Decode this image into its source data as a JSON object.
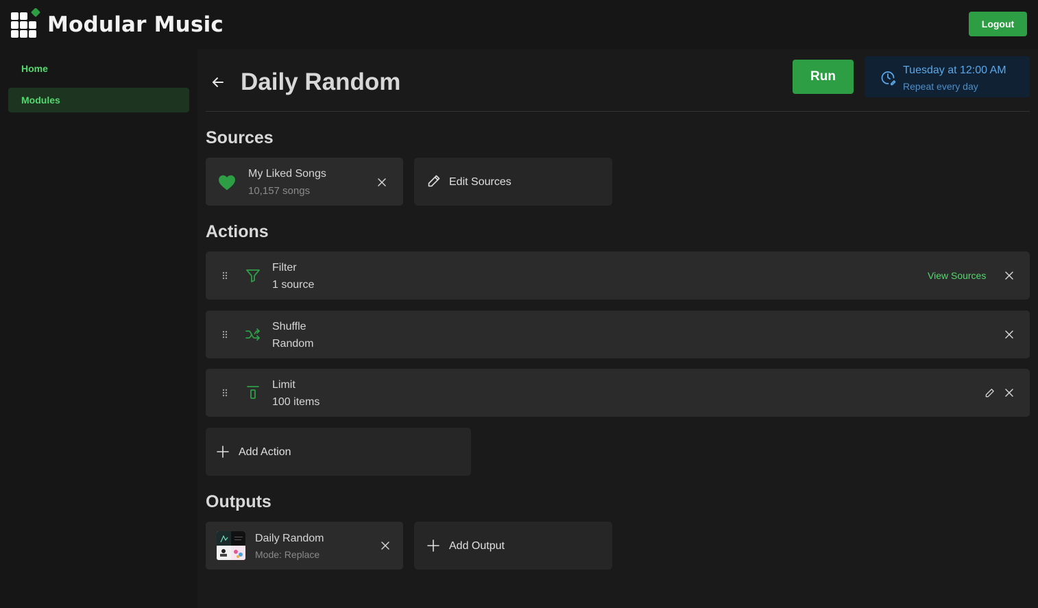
{
  "app": {
    "title": "Modular Music",
    "logout_label": "Logout"
  },
  "sidebar": {
    "items": [
      {
        "label": "Home"
      },
      {
        "label": "Modules"
      }
    ]
  },
  "page": {
    "title": "Daily Random",
    "run_label": "Run",
    "schedule": {
      "time": "Tuesday at 12:00 AM",
      "repeat": "Repeat every day"
    }
  },
  "sources": {
    "heading": "Sources",
    "items": [
      {
        "name": "My Liked Songs",
        "detail": "10,157 songs",
        "icon": "heart-icon"
      }
    ],
    "edit_label": "Edit Sources"
  },
  "actions": {
    "heading": "Actions",
    "items": [
      {
        "name": "Filter",
        "detail": "1 source",
        "icon": "filter-icon",
        "link": "View Sources"
      },
      {
        "name": "Shuffle",
        "detail": "Random",
        "icon": "shuffle-icon"
      },
      {
        "name": "Limit",
        "detail": "100 items",
        "icon": "limit-icon"
      }
    ],
    "add_label": "Add Action"
  },
  "outputs": {
    "heading": "Outputs",
    "items": [
      {
        "name": "Daily Random",
        "detail": "Mode: Replace"
      }
    ],
    "add_label": "Add Output"
  },
  "colors": {
    "accent": "#2e9e45",
    "accent_text": "#54d86e",
    "schedule_bg": "#0f2133",
    "schedule_text": "#5aa8ea",
    "background": "#161616",
    "card": "#2b2b2b"
  }
}
